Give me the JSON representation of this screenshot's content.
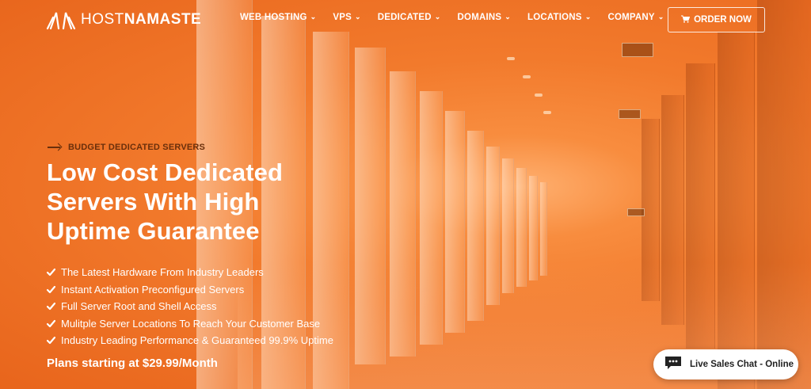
{
  "brand": {
    "logo_light": "HOST",
    "logo_bold": "NAMASTE",
    "logo_icon": "namaste-hands-icon",
    "color_accent": "#f07a2a"
  },
  "nav": {
    "items": [
      {
        "label": "WEB HOSTING",
        "icon": "chevron-down-icon"
      },
      {
        "label": "VPS",
        "icon": "chevron-down-icon"
      },
      {
        "label": "DEDICATED",
        "icon": "chevron-down-icon"
      },
      {
        "label": "DOMAINS",
        "icon": "chevron-down-icon"
      },
      {
        "label": "LOCATIONS",
        "icon": "chevron-down-icon"
      },
      {
        "label": "COMPANY",
        "icon": "chevron-down-icon"
      }
    ],
    "order_button": {
      "label": "ORDER NOW",
      "icon": "cart-icon"
    }
  },
  "hero": {
    "eyebrow": "BUDGET DEDICATED SERVERS",
    "title_lines": [
      "Low Cost Dedicated",
      "Servers With High",
      "Uptime Guarantee"
    ],
    "features": [
      "The Latest Hardware From Industry Leaders",
      "Instant Activation Preconfigured Servers",
      "Full Server Root and Shell Access",
      "Mulitple Server Locations To Reach Your Customer Base",
      "Industry Leading Performance & Guaranteed 99.9% Uptime"
    ],
    "plans_text": "Plans starting at $29.99/Month"
  },
  "chat": {
    "label": "Live Sales Chat - Online",
    "icon": "chat-bubble-icon"
  }
}
